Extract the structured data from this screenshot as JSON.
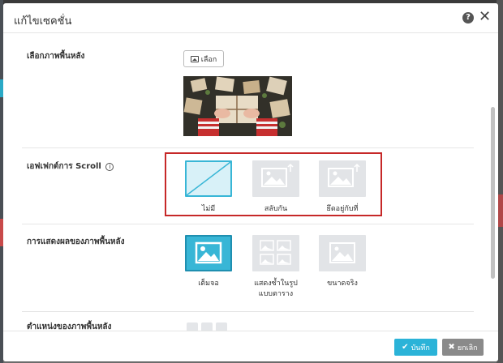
{
  "dialog": {
    "title": "แก้ไขเซคชั่น"
  },
  "background_image": {
    "label": "เลือกภาพพื้นหลัง",
    "choose_label": "เลือก"
  },
  "scroll_effect": {
    "label": "เอฟเฟกต์การ Scroll",
    "options": [
      {
        "label": "ไม่มี",
        "selected": true
      },
      {
        "label": "สลับกัน",
        "selected": false
      },
      {
        "label": "ยึดอยู่กับที่",
        "selected": false
      }
    ]
  },
  "bg_display": {
    "label": "การแสดงผลของภาพพื้นหลัง",
    "options": [
      {
        "label": "เต็มจอ",
        "selected": true
      },
      {
        "label": "แสดงซ้ำในรูป",
        "label2": "แบบตาราง",
        "selected": false
      },
      {
        "label": "ขนาดจริง",
        "selected": false
      }
    ]
  },
  "bg_position": {
    "label": "ตำแหน่งของภาพพื้นหลัง"
  },
  "footer": {
    "save_label": "บันทึก",
    "cancel_label": "ยกเลิก"
  },
  "colors": {
    "accent": "#2bb3d8",
    "highlight": "#c62828",
    "cancel": "#8a8a8a"
  }
}
